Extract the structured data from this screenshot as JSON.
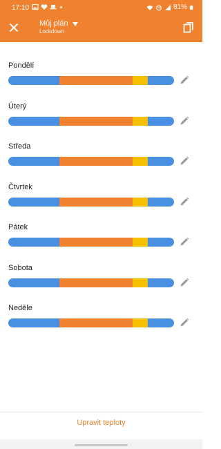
{
  "status_bar": {
    "time": "17:10",
    "battery": "81%"
  },
  "header": {
    "title": "Můj plán",
    "subtitle": "Lockdown",
    "background_color": "#f0812e"
  },
  "colors": {
    "blue": "#4a90e2",
    "orange": "#f0812e",
    "yellow": "#f5c000"
  },
  "schedule_segments": [
    {
      "color": "blue",
      "fraction": 0.31
    },
    {
      "color": "orange",
      "fraction": 0.44
    },
    {
      "color": "yellow",
      "fraction": 0.09
    },
    {
      "color": "blue",
      "fraction": 0.16
    }
  ],
  "days": [
    {
      "label": "Pondělí"
    },
    {
      "label": "Úterý"
    },
    {
      "label": "Středa"
    },
    {
      "label": "Čtvrtek"
    },
    {
      "label": "Pátek"
    },
    {
      "label": "Sobota"
    },
    {
      "label": "Neděle"
    }
  ],
  "footer": {
    "action_label": "Upravit teploty"
  }
}
